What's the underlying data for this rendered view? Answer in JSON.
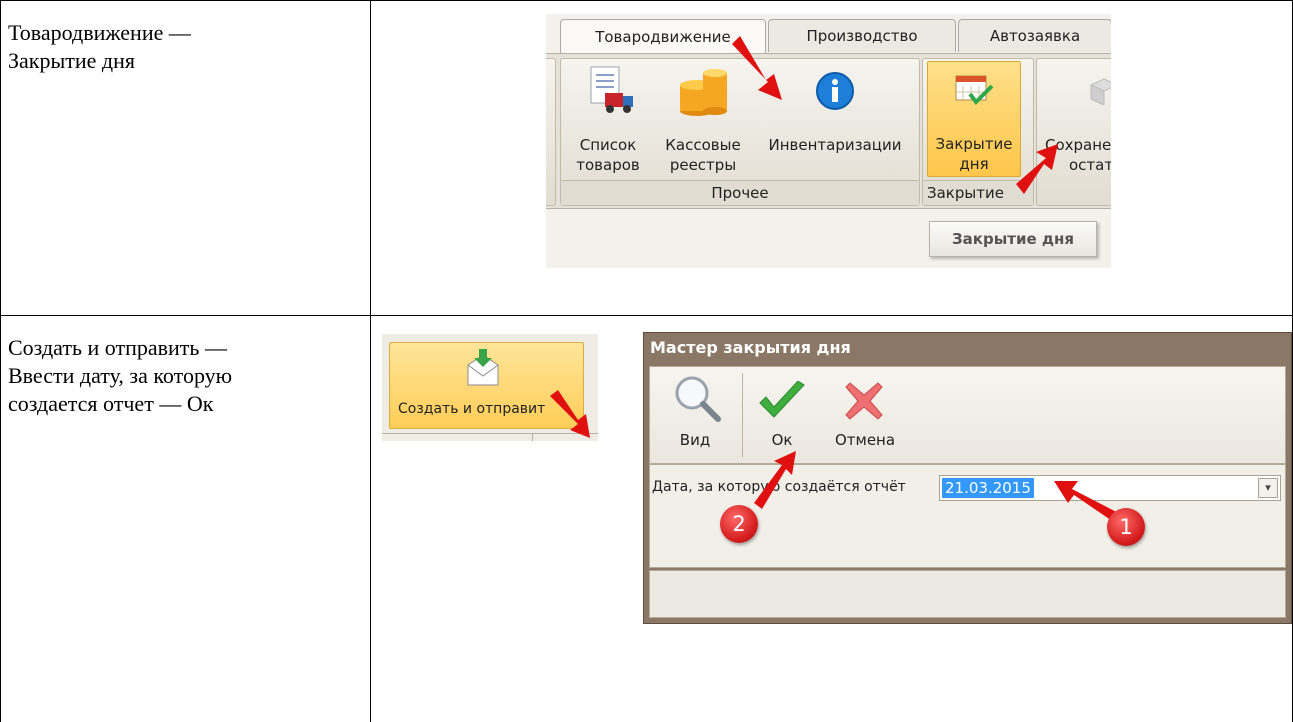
{
  "rows": [
    {
      "instruction": "Товародвижение —\nЗакрытие дня",
      "ribbon": {
        "tabs": [
          "Товародвижение",
          "Производство",
          "Автозаявка"
        ],
        "buttons": [
          {
            "line1": "Список",
            "line2": "товаров",
            "icon": "goods-list-icon"
          },
          {
            "line1": "Кассовые",
            "line2": "реестры",
            "icon": "coins-icon"
          },
          {
            "line1": "Инвентаризации",
            "line2": "",
            "icon": "info-icon"
          },
          {
            "line1": "Закрытие",
            "line2": "дня",
            "icon": "calendar-check-icon"
          },
          {
            "line1": "Сохране",
            "line2": "остат",
            "icon": "box-icon"
          }
        ],
        "groups": [
          "Прочее",
          "Закрытие"
        ],
        "tooltip": "Закрытие дня"
      }
    },
    {
      "instruction": "Создать и отправить —\nВвести дату, за которую\nсоздается отчет — Ок",
      "button": {
        "label": "Создать и отправит",
        "icon": "envelope-download-icon"
      },
      "dialog": {
        "title": "Мастер закрытия дня",
        "toolbar": [
          {
            "label": "Вид",
            "icon": "magnifier-icon"
          },
          {
            "label": "Ок",
            "icon": "checkmark-icon"
          },
          {
            "label": "Отмена",
            "icon": "cross-icon"
          }
        ],
        "date_label": "Дата, за которую создаётся отчёт",
        "date_value": "21.03.2015",
        "badges": [
          "1",
          "2"
        ]
      }
    }
  ],
  "colors": {
    "accent": "#ffcd57",
    "badge": "#d41c1c",
    "arrow": "#e01010",
    "dialog_frame": "#8a7765"
  }
}
